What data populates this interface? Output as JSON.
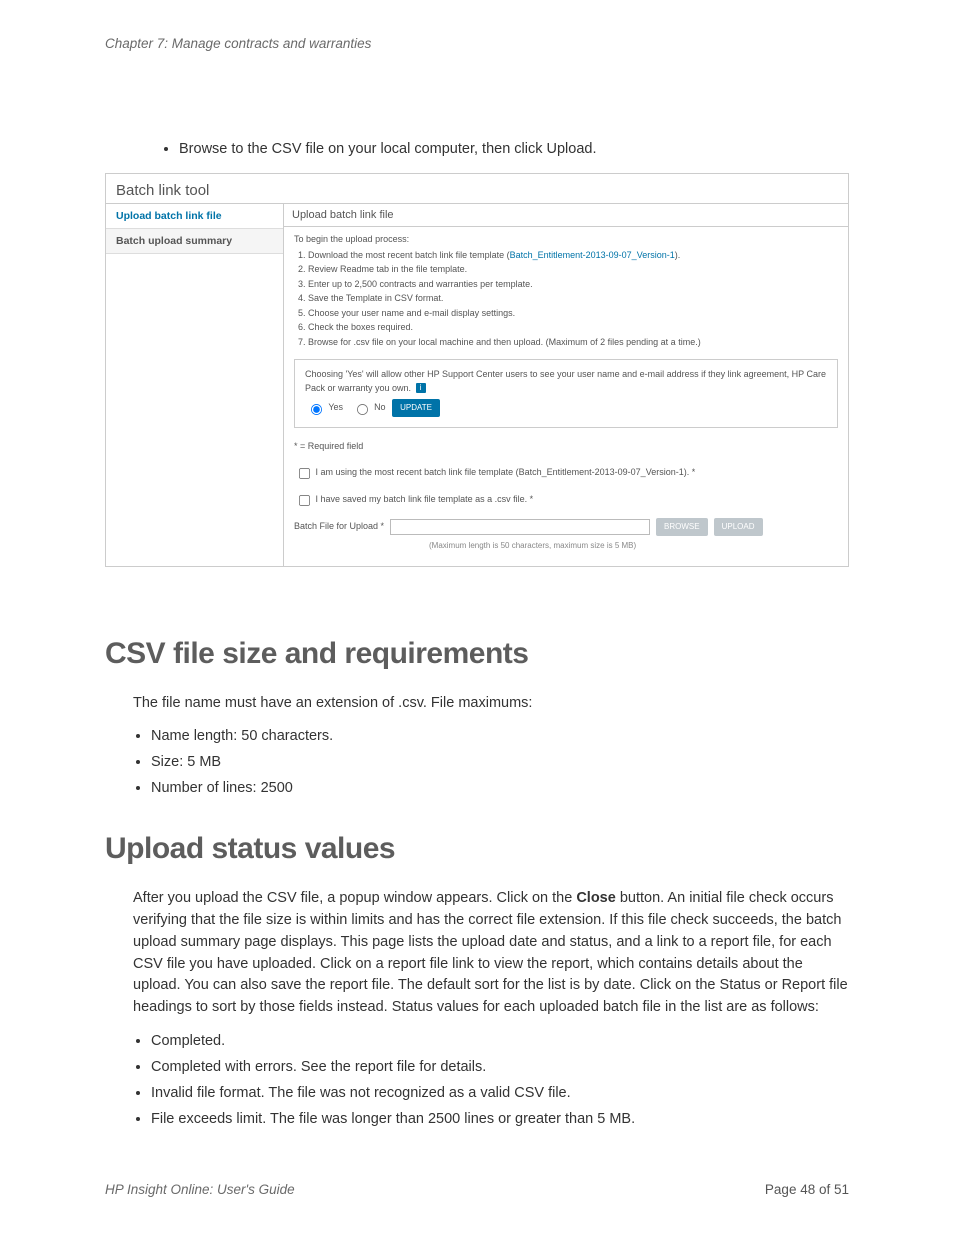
{
  "chapter_header": "Chapter 7: Manage contracts and warranties",
  "intro_bullet": "Browse to the CSV file on your local computer, then click Upload.",
  "screenshot": {
    "window_title": "Batch link tool",
    "nav": {
      "item1": "Upload batch link file",
      "item2": "Batch upload summary"
    },
    "panel_title": "Upload batch link file",
    "process_intro": "To begin the upload process:",
    "steps": {
      "s1a": "Download the most recent batch link file template (",
      "s1b": "Batch_Entitlement-2013-09-07_Version-1",
      "s1c": ").",
      "s2": "Review Readme tab in the file template.",
      "s3": "Enter up to 2,500 contracts and warranties per template.",
      "s4": "Save the Template in CSV format.",
      "s5": "Choose your user name and e-mail display settings.",
      "s6": "Check the boxes required.",
      "s7": "Browse for .csv file on your local machine and then upload. (Maximum of 2 files pending at a time.)"
    },
    "consent_text": "Choosing 'Yes' will allow other HP Support Center users to see your user name and e-mail address if they link agreement, HP Care Pack or warranty you own.",
    "radio_yes": "Yes",
    "radio_no": "No",
    "update_btn": "UPDATE",
    "required_note": "* = Required field",
    "chk1": "I am using the most recent batch link file template (Batch_Entitlement-2013-09-07_Version-1). *",
    "chk2": "I have saved my batch link file template as a .csv file. *",
    "file_label": "Batch File for Upload *",
    "browse_btn": "BROWSE",
    "upload_btn": "UPLOAD",
    "file_note": "(Maximum length is 50 characters, maximum size is 5 MB)"
  },
  "section1": {
    "heading": "CSV file size and requirements",
    "p1": "The file name must have an extension of .csv. File maximums:",
    "b1": "Name length: 50 characters.",
    "b2": "Size: 5 MB",
    "b3": "Number of lines: 2500"
  },
  "section2": {
    "heading": "Upload status values",
    "p1a": "After you upload the CSV file, a popup window appears. Click on the ",
    "p1b": "Close",
    "p1c": " button. An initial file check occurs verifying that the file size is within limits and has the correct file extension. If this file check succeeds, the batch upload summary page displays. This page lists the upload date and status, and a link to a report file, for each CSV file you have uploaded. Click on a report file link to view the report, which contains details about the upload. You can also save the report file. The default sort for the list is by date. Click on the Status or Report file headings to sort by those fields instead. Status values for each uploaded batch file in the list are as follows:",
    "b1": "Completed.",
    "b2": "Completed with errors. See the report file for details.",
    "b3": "Invalid file format. The file was not recognized as a valid CSV file.",
    "b4": "File exceeds limit. The file was longer than 2500 lines or greater than 5 MB."
  },
  "footer": {
    "left": "HP Insight Online: User's Guide",
    "right": "Page 48 of 51"
  }
}
